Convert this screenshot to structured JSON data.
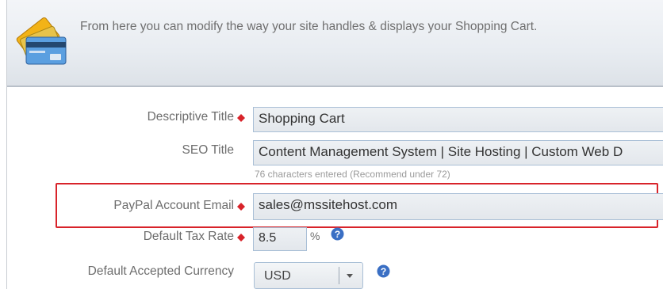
{
  "banner": {
    "description": "From here you can modify the way your site handles & displays your Shopping Cart.",
    "icon": "credit-card-icon"
  },
  "form": {
    "descriptive_title": {
      "label": "Descriptive Title",
      "value": "Shopping Cart",
      "required": true
    },
    "seo_title": {
      "label": "SEO Title",
      "value": "Content Management System | Site Hosting | Custom Web D",
      "hint": "76  characters entered   (Recommend under 72)"
    },
    "paypal_email": {
      "label": "PayPal Account Email",
      "value": "sales@mssitehost.com",
      "required": true
    },
    "tax_rate": {
      "label": "Default Tax Rate",
      "value": "8.5",
      "unit": "%",
      "required": true
    },
    "currency": {
      "label": "Default Accepted Currency",
      "value": "USD"
    }
  },
  "colors": {
    "required_marker": "#d8232a",
    "highlight_border": "#d8232a",
    "help_icon": "#3a6fc4"
  }
}
